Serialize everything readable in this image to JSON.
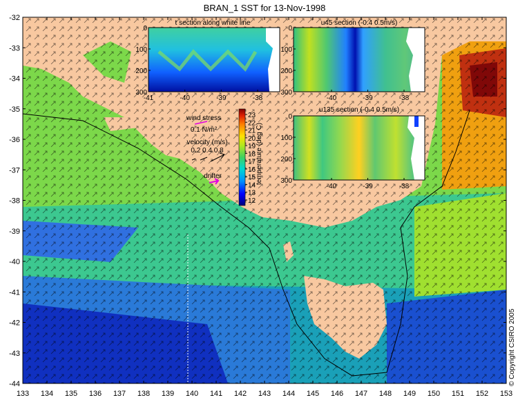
{
  "title": "BRAN_1 SST for 13-Nov-1998",
  "copyright": "© Copyright CSIRO 2005",
  "map": {
    "lon_ticks": [
      "133",
      "134",
      "135",
      "136",
      "137",
      "138",
      "139",
      "140",
      "141",
      "142",
      "143",
      "144",
      "145",
      "146",
      "147",
      "148",
      "149",
      "150",
      "151",
      "152",
      "153"
    ],
    "lat_ticks": [
      "-32",
      "-33",
      "-34",
      "-35",
      "-36",
      "-37",
      "-38",
      "-39",
      "-40",
      "-41",
      "-42",
      "-43",
      "-44"
    ]
  },
  "colorbar": {
    "label": "temperature (deg C)",
    "ticks": [
      "23",
      "22",
      "21",
      "20",
      "19",
      "18",
      "17",
      "16",
      "15",
      "14",
      "13",
      "12"
    ],
    "colors": [
      "#00007a",
      "#0000c8",
      "#0030ff",
      "#0080ff",
      "#00c0ff",
      "#20e0c0",
      "#40d080",
      "#60d040",
      "#a0e020",
      "#e0f020",
      "#ffd000",
      "#ffa000",
      "#ff6000",
      "#e03000",
      "#b01000",
      "#800000"
    ]
  },
  "legend": {
    "wind_title": "wind stress",
    "wind_scale": "0.1 N/m²",
    "velocity_title": "velocity (m/s)",
    "velocity_scale": "0.2 0.4 0.8",
    "drifter": "drifter"
  },
  "insets": {
    "t_section": {
      "title": "t section along white line",
      "x_ticks": [
        "-41",
        "-40",
        "-39",
        "-38"
      ],
      "y_ticks": [
        "0",
        "100",
        "200",
        "300"
      ]
    },
    "u45_section": {
      "title": "u45 section (-0.4     0.5m/s)",
      "x_ticks": [
        "-40",
        "-39",
        "-38"
      ],
      "y_ticks": [
        "0",
        "100",
        "200",
        "300"
      ]
    },
    "u135_section": {
      "title": "u135 section (-0.4     0.5m/s)",
      "x_ticks": [
        "-40",
        "-39",
        "-38"
      ],
      "y_ticks": [
        "0",
        "100",
        "200",
        "300"
      ]
    }
  }
}
